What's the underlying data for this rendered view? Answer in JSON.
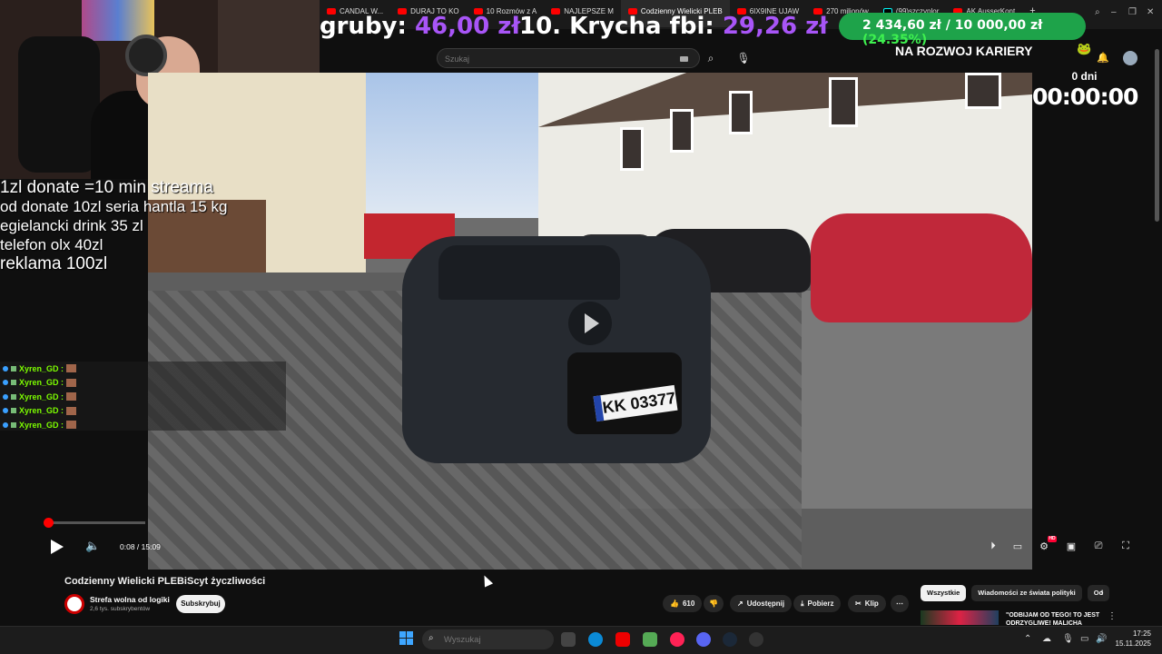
{
  "browser_tabs": [
    {
      "label": "CANDAL W..."
    },
    {
      "label": "DURAJ TO KO"
    },
    {
      "label": "10 Rozmów z A"
    },
    {
      "label": "NAJLEPSZE M"
    },
    {
      "label": "Codzienny Wielicki PLEB",
      "active": true
    },
    {
      "label": "6IX9INE UJAW"
    },
    {
      "label": "270 milionów"
    },
    {
      "label": "(99)szczyplor"
    },
    {
      "label": "AK AusserKont"
    }
  ],
  "overlay": {
    "gruby_label": "gruby:",
    "gruby_value": "46,00 zł",
    "krycha_label": "10. Krycha fbi:",
    "krycha_value": "29,26 zł",
    "goal_current": "2 434,60 zł",
    "goal_sep": " / ",
    "goal_target": "10 000,00 zł",
    "goal_pct": "(24.35%)",
    "goal_fraction": 0.2435,
    "kariera": "NA ROZWOJ KARIERY",
    "days": "0 dni",
    "timer": "00:00:00"
  },
  "donate_info": [
    "1zl donate =10 min streama",
    "od donate 10zl seria hantla 15 kg",
    "egielancki drink 35 zl",
    "telefon olx 40zl",
    "reklama 100zl"
  ],
  "chat": [
    {
      "user": "Xyren_GD :"
    },
    {
      "user": "Xyren_GD :"
    },
    {
      "user": "Xyren_GD :"
    },
    {
      "user": "Xyren_GD :"
    },
    {
      "user": "Xyren_GD :"
    }
  ],
  "search": {
    "placeholder": "Szukaj"
  },
  "player": {
    "time": "0:08 / 15:09",
    "progress_fraction": 0.009,
    "plate": "KK 03377",
    "hd": "HD"
  },
  "video": {
    "title": "Codzienny Wielicki PLEBiScyt życzliwości",
    "channel": "Strefa wolna od logiki",
    "subs": "2,6 tys. subskrybentów",
    "subscribe": "Subskrybuj",
    "likes": "610",
    "share": "Udostępnij",
    "download": "Pobierz",
    "clip": "Klip"
  },
  "filters": [
    "Wszystkie",
    "Wiadomości ze świata polityki",
    "Od"
  ],
  "recommended": {
    "title": "\"ODBIJAM OD TEGO! TO JEST ODRZYGLIWE! MALICHA"
  },
  "taskbar": {
    "search_placeholder": "Wyszukaj",
    "time": "17:25",
    "date": "15.11.2025"
  },
  "colors": {
    "accent": "#a855f7",
    "goal_green": "#1ea34a",
    "youtube_red": "#ff0000"
  }
}
